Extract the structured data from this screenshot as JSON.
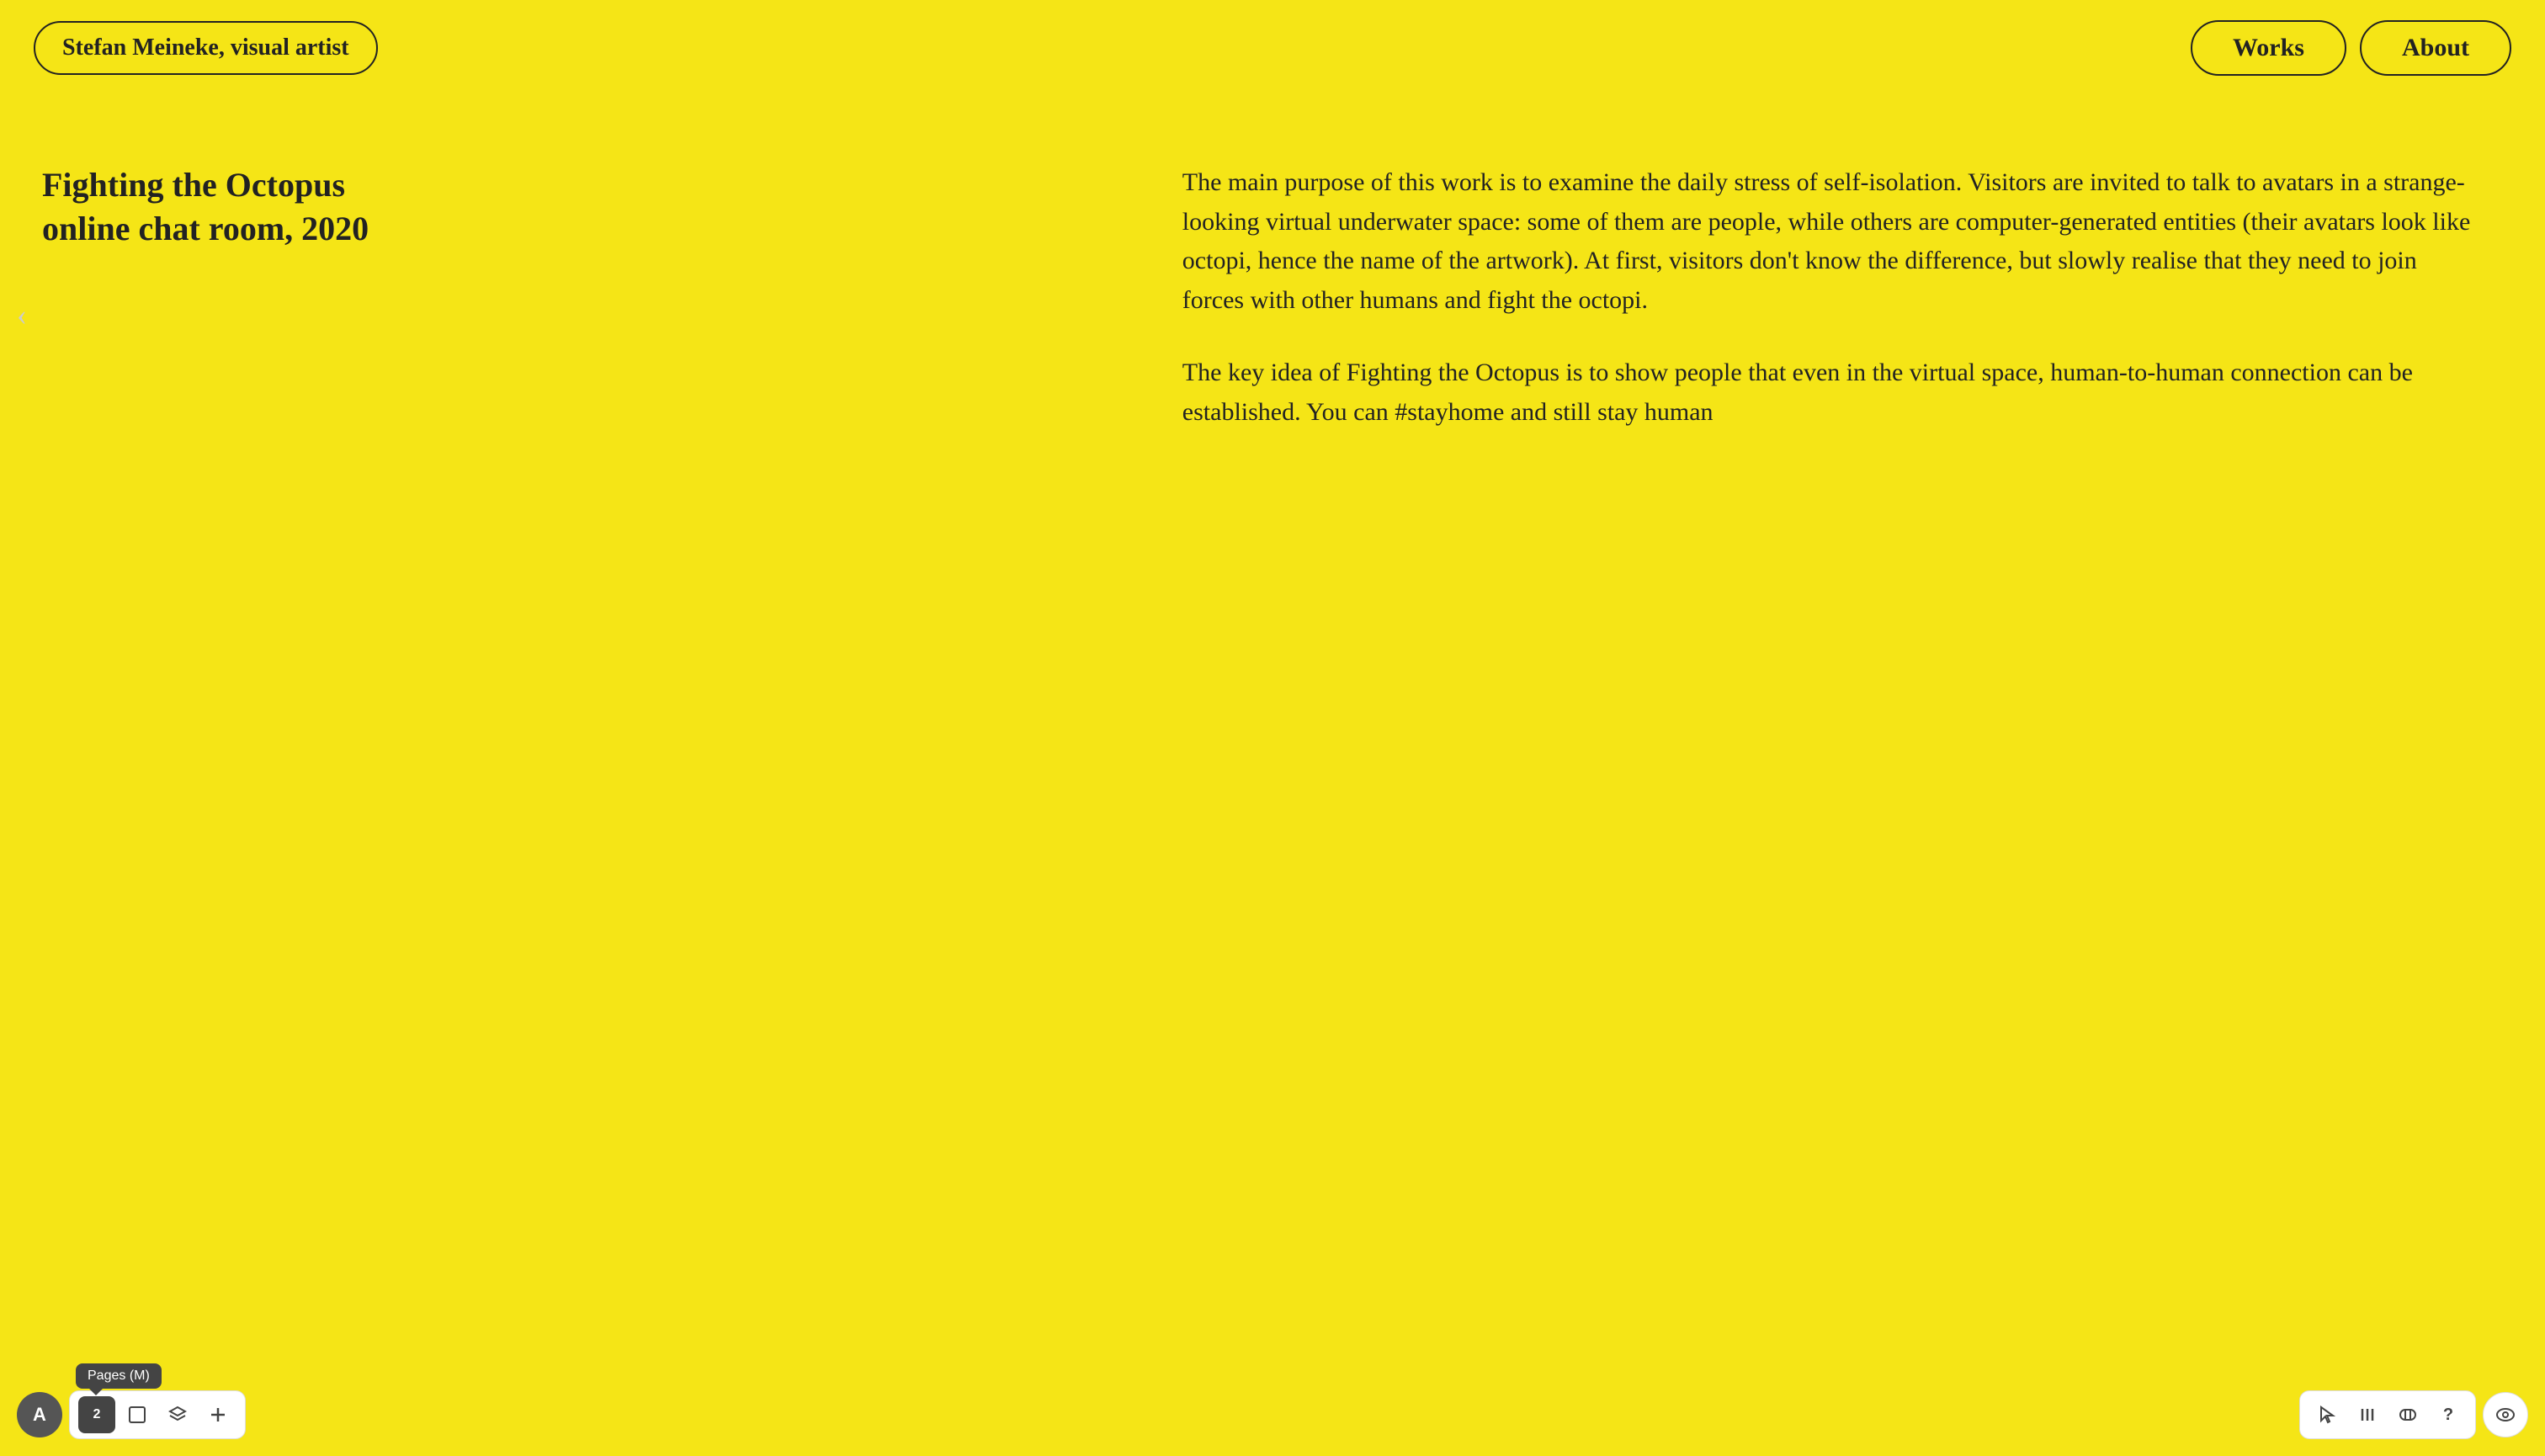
{
  "header": {
    "site_title": "Stefan Meineke, visual artist",
    "nav": {
      "works_label": "Works",
      "about_label": "About"
    }
  },
  "main": {
    "artwork": {
      "title_line1": "Fighting the Octopus",
      "title_line2": "online chat room, 2020",
      "description_para1": "The main purpose of this work is to examine the daily stress of self-isolation. Visitors are invited to talk to avatars in a strange-looking virtual underwater space: some of them are people, while others are computer-generated entities (their avatars look like octopi, hence the name of the artwork). At first, visitors don't know the difference, but slowly realise that they need to join forces with other humans and fight the octopi.",
      "description_para2": "The key idea of Fighting the Octopus is to show people that even in the virtual space, human-to-human connection can be established. You can #stayhome and still stay human"
    },
    "prev_arrow": "‹"
  },
  "bottom_toolbar_left": {
    "avatar_label": "A",
    "pages_tooltip": "Pages (M)",
    "pages_number": "2",
    "icons": [
      "pages",
      "frame",
      "layers",
      "add"
    ]
  },
  "bottom_toolbar_right": {
    "icons": [
      "arrow",
      "vertical-lines",
      "layout",
      "question"
    ],
    "eye_icon": "eye"
  },
  "colors": {
    "background": "#F5E516",
    "text": "#222222",
    "border": "#222222",
    "toolbar_bg": "#ffffff",
    "avatar_bg": "#555555"
  }
}
